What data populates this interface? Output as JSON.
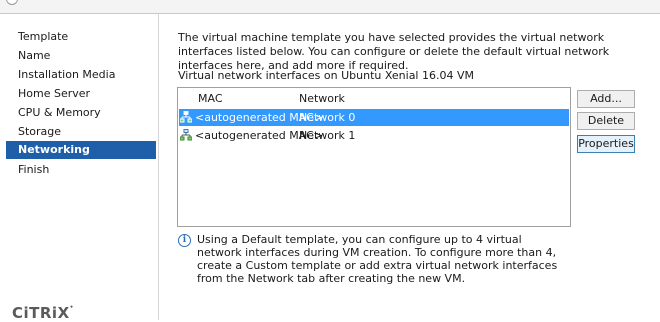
{
  "sidebar": {
    "items": [
      {
        "label": "Template",
        "active": false
      },
      {
        "label": "Name",
        "active": false
      },
      {
        "label": "Installation Media",
        "active": false
      },
      {
        "label": "Home Server",
        "active": false
      },
      {
        "label": "CPU & Memory",
        "active": false
      },
      {
        "label": "Storage",
        "active": false
      },
      {
        "label": "Networking",
        "active": true
      },
      {
        "label": "Finish",
        "active": false
      }
    ],
    "logo_text": "CiTRiX"
  },
  "main": {
    "intro": "The virtual machine template you have selected provides the virtual network interfaces listed below. You can configure or delete the default virtual network interfaces here, and add more if required.",
    "vnic_label": "Virtual network interfaces on Ubuntu Xenial 16.04 VM",
    "table": {
      "headers": {
        "mac": "MAC",
        "network": "Network"
      },
      "rows": [
        {
          "mac": "<autogenerated MAC>",
          "network": "Network 0",
          "selected": true
        },
        {
          "mac": "<autogenerated MAC>",
          "network": "Network 1",
          "selected": false
        }
      ]
    },
    "buttons": {
      "add": "Add...",
      "delete": "Delete",
      "properties": "Properties"
    },
    "info": "Using a Default template, you can configure up to 4 virtual network interfaces during VM creation. To configure more than 4, create a Custom template or add extra virtual network interfaces from the Network tab after creating the new VM."
  },
  "colors": {
    "active_nav": "#1f5ea8",
    "selected_row": "#3399ff",
    "info_icon": "#2a6ebb"
  }
}
